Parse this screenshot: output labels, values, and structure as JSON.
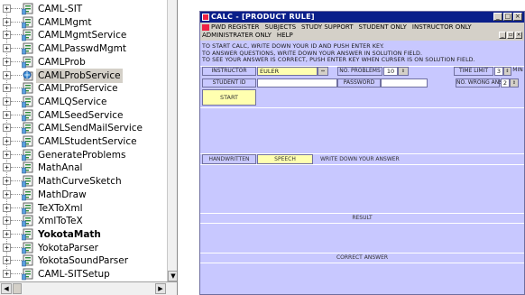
{
  "tree": {
    "items": [
      {
        "label": "CAML-SIT",
        "expander": "+"
      },
      {
        "label": "CAMLMgmt",
        "expander": "+"
      },
      {
        "label": "CAMLMgmtService",
        "expander": "+"
      },
      {
        "label": "CAMLPasswdMgmt",
        "expander": "+"
      },
      {
        "label": "CAMLProb",
        "expander": "+"
      },
      {
        "label": "CAMLProbService",
        "expander": "+",
        "selected": true
      },
      {
        "label": "CAMLProfService",
        "expander": "+"
      },
      {
        "label": "CAMLQService",
        "expander": "+"
      },
      {
        "label": "CAMLSeedService",
        "expander": "+"
      },
      {
        "label": "CAMLSendMailService",
        "expander": "+"
      },
      {
        "label": "CAMLStudentService",
        "expander": "+"
      },
      {
        "label": "GenerateProblems",
        "expander": "+"
      },
      {
        "label": "MathAnal",
        "expander": "+"
      },
      {
        "label": "MathCurveSketch",
        "expander": "+"
      },
      {
        "label": "MathDraw",
        "expander": "+"
      },
      {
        "label": "TeXToXml",
        "expander": "+"
      },
      {
        "label": "XmlToTeX",
        "expander": "+"
      },
      {
        "label": "YokotaMath",
        "expander": "+",
        "bold": true
      },
      {
        "label": "YokotaParser",
        "expander": "+"
      },
      {
        "label": "YokotaSoundParser",
        "expander": "+"
      },
      {
        "label": "CAML-SITSetup",
        "expander": "+"
      }
    ]
  },
  "window": {
    "title": "CALC - [PRODUCT RULE]",
    "menu_row1": [
      "PWD REGISTER",
      "SUBJECTS",
      "STUDY SUPPORT",
      "STUDENT ONLY",
      "INSTRUCTOR ONLY"
    ],
    "menu_row2": [
      "ADMINISTRATER ONLY",
      "HELP"
    ],
    "instructions": [
      "TO START CALC, WRITE DOWN YOUR ID AND PUSH ENTER KEY.",
      "TO ANSWER QUESTIONS, WRITE DOWN YOUR ANSWER IN SOLUTION FIELD.",
      "TO SEE YOUR ANSWER IS CORRECT, PUSH ENTER KEY WHEN CURSER IS ON SOLUTION FIELD."
    ],
    "instructor_label": "INSTRUCTOR",
    "instructor_value": "EULER",
    "no_problems_label": "NO. PROBLEMS",
    "no_problems_value": "10",
    "time_limit_label": "TIME LIMIT",
    "time_limit_value": "3",
    "time_limit_unit": "MIN",
    "student_id_label": "STUDENT ID",
    "student_id_value": "",
    "password_label": "PASSWORD",
    "password_value": "",
    "no_wrong_label": "NO. WRONG ANS",
    "no_wrong_value": "2",
    "start_label": "START",
    "handwritten_label": "HANDWRITTEN",
    "speech_label": "SPEECH",
    "answer_prompt": "WRITE DOWN YOUR ANSWER",
    "result_label": "RESULT",
    "correct_answer_label": "CORRECT ANSWER"
  },
  "colors": {
    "titlebar": "#0a1f8a",
    "panel": "#c8c8ff",
    "highlight": "#ffffb0"
  }
}
